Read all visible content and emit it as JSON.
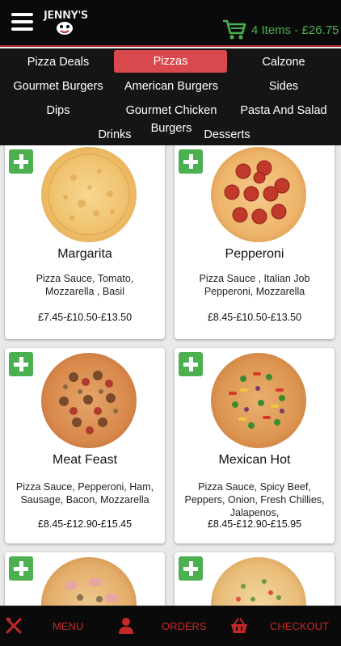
{
  "header": {
    "logo_text": "JENNY'S",
    "cart_text": "4 Items - £26.75"
  },
  "categories": {
    "pizza_deals": "Pizza Deals",
    "pizzas": "Pizzas",
    "calzone": "Calzone",
    "gourmet_burgers": "Gourmet Burgers",
    "american_burgers": "American Burgers",
    "sides": "Sides",
    "dips": "Dips",
    "gourmet_chicken": "Gourmet Chicken",
    "burgers": "Burgers",
    "pasta_and_salad": "Pasta And Salad",
    "drinks": "Drinks",
    "desserts": "Desserts"
  },
  "products": [
    {
      "name": "Margarita",
      "desc": "Pizza Sauce, Tomato, Mozzarella , Basil",
      "price": "£7.45-£10.50-£13.50"
    },
    {
      "name": "Pepperoni",
      "desc": "Pizza Sauce , Italian Job Pepperoni, Mozzarella",
      "price": "£8.45-£10.50-£13.50"
    },
    {
      "name": "Meat Feast",
      "desc": "Pizza Sauce, Pepperoni, Ham, Sausage, Bacon, Mozzarella",
      "price": "£8.45-£12.90-£15.45"
    },
    {
      "name": "Mexican Hot",
      "desc": "Pizza Sauce, Spicy Beef, Peppers, Onion, Fresh Chillies, Jalapenos,",
      "price": "£8.45-£12.90-£15.95"
    }
  ],
  "bottom_nav": {
    "menu": "MENU",
    "orders": "ORDERS",
    "checkout": "CHECKOUT"
  },
  "colors": {
    "accent_red": "#d9484c",
    "cart_green": "#4caf50",
    "nav_red": "#c62828"
  }
}
